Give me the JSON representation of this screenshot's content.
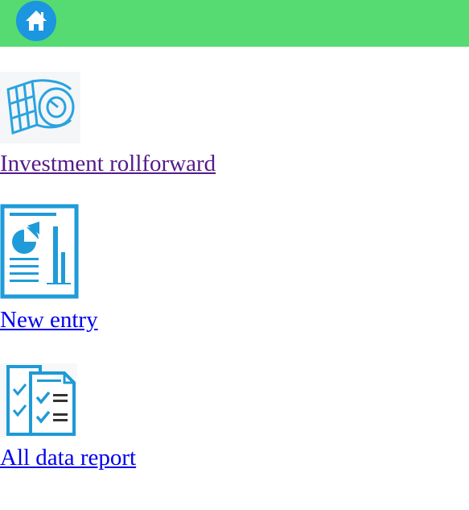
{
  "header": {
    "home_icon": "home-icon",
    "bar_color": "#55db72",
    "button_color": "#1b96df"
  },
  "tiles": [
    {
      "label": "Investment rollforward",
      "icon": "coin-roll-icon",
      "link_color": "#551a8b"
    },
    {
      "label": "New entry",
      "icon": "report-chart-icon",
      "link_color": "#0000ee"
    },
    {
      "label": "All data report",
      "icon": "checklist-icon",
      "link_color": "#0000ee"
    }
  ]
}
